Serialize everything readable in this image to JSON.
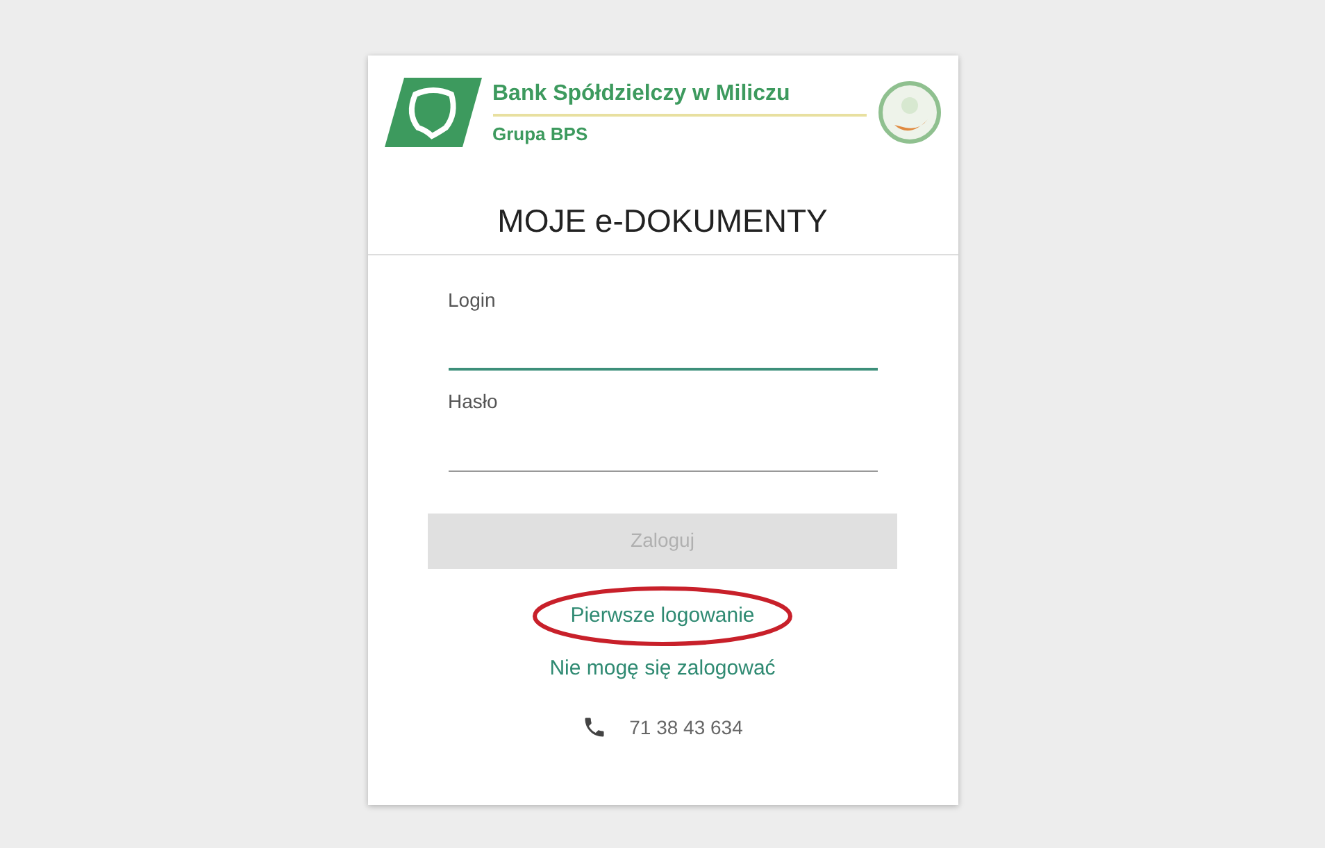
{
  "brand": {
    "name": "Bank Spółdzielczy w Miliczu",
    "group": "Grupa BPS"
  },
  "title": "MOJE e-DOKUMENTY",
  "fields": [
    {
      "label": "Login",
      "focused": true
    },
    {
      "label": "Hasło",
      "focused": false
    }
  ],
  "login_button": {
    "label": "Zaloguj",
    "disabled": true
  },
  "links": [
    {
      "label": "Pierwsze logowanie",
      "highlighted": true
    },
    {
      "label": "Nie mogę się zalogować",
      "highlighted": false
    }
  ],
  "phone": "71 38 43 634"
}
